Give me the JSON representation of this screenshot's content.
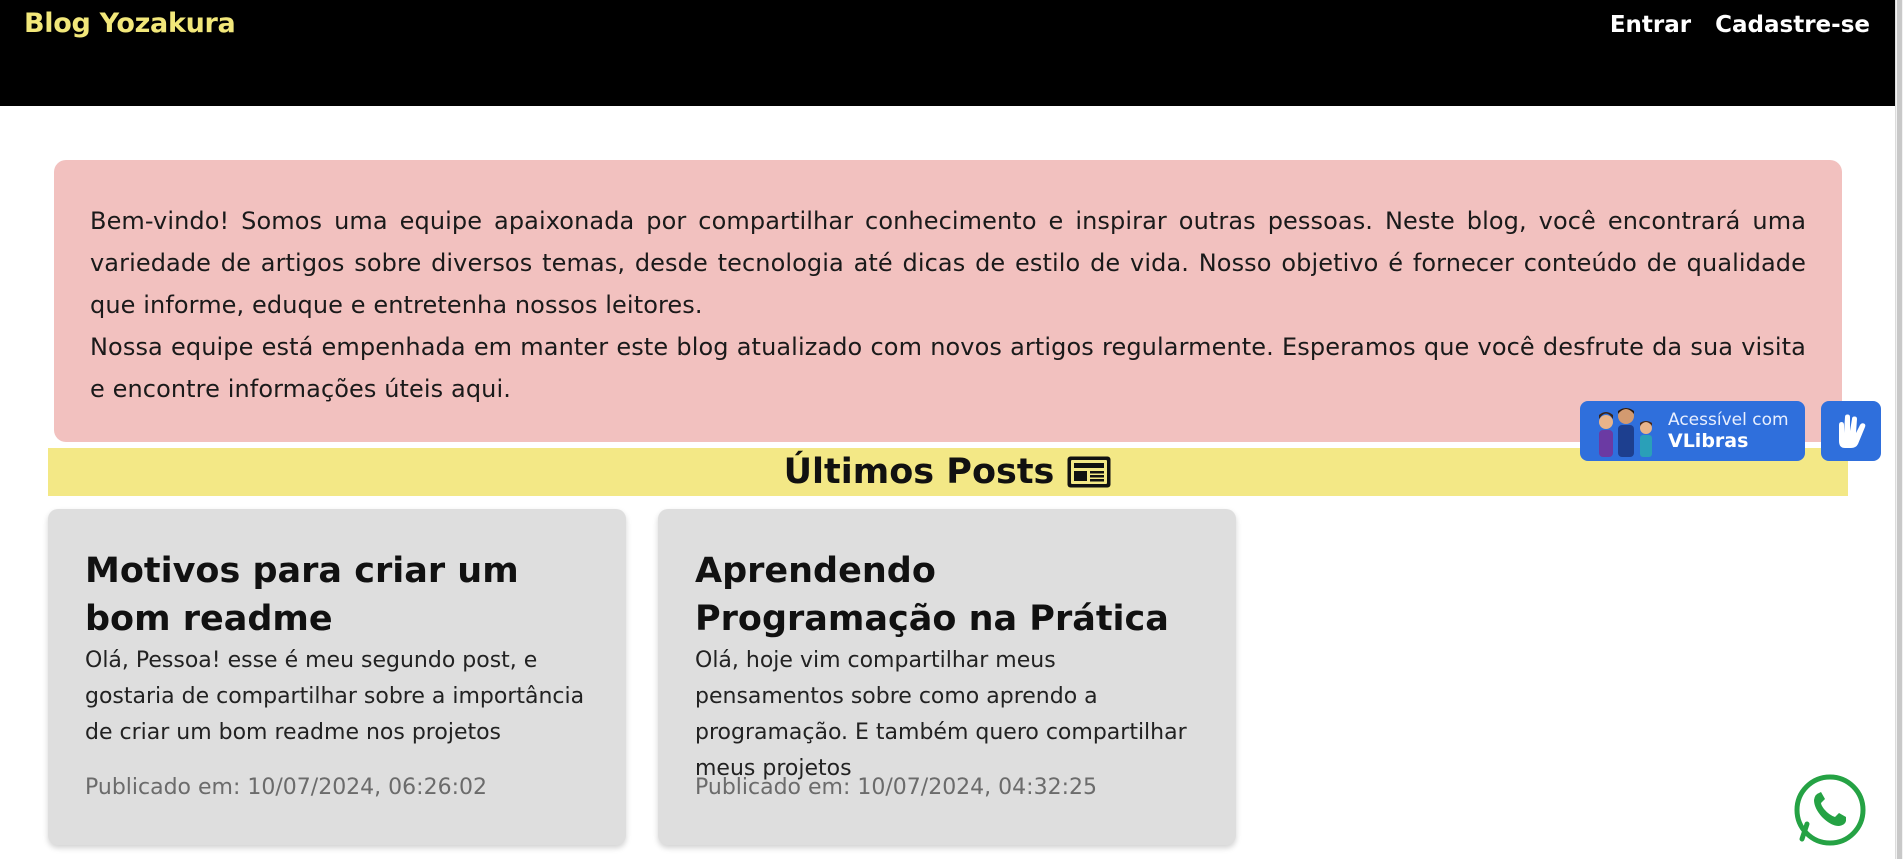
{
  "header": {
    "brand": "Blog Yozakura",
    "nav": [
      {
        "label": "Entrar"
      },
      {
        "label": "Cadastre-se"
      }
    ]
  },
  "welcome": {
    "paragraph1": "Bem-vindo! Somos uma equipe apaixonada por compartilhar conhecimento e inspirar outras pessoas. Neste blog, você encontrará uma variedade de artigos sobre diversos temas, desde tecnologia até dicas de estilo de vida. Nosso objetivo é fornecer conteúdo de qualidade que informe, eduque e entretenha nossos leitores.",
    "paragraph2": "Nossa equipe está empenhada em manter este blog atualizado com novos artigos regularmente. Esperamos que você desfrute da sua visita e encontre informações úteis aqui."
  },
  "posts_section": {
    "title": "Últimos Posts",
    "icon": "newspaper-icon"
  },
  "posts": [
    {
      "title": "Motivos para criar um bom readme",
      "excerpt": "Olá, Pessoa! esse é meu segundo post, e gostaria de compartilhar sobre a importância de criar um bom readme nos projetos",
      "published": "Publicado em: 10/07/2024, 06:26:02"
    },
    {
      "title": "Aprendendo Programação na Prática",
      "excerpt": "Olá, hoje vim compartilhar meus pensamentos sobre como aprendo a programação. E também quero compartilhar meus projetos",
      "published": "Publicado em: 10/07/2024, 04:32:25"
    }
  ],
  "vlibras": {
    "line1": "Acessível com",
    "line2": "VLibras",
    "hand_icon": "sign-language-hand-icon"
  },
  "whatsapp": {
    "icon": "whatsapp-icon"
  },
  "colors": {
    "header_bg": "#000000",
    "brand": "#f2e77a",
    "welcome_bg": "#f2c1bf",
    "posts_band_bg": "#f3e886",
    "card_bg": "#dedede",
    "vlibras_blue": "#2f6fdc",
    "whatsapp_green": "#25a244"
  }
}
